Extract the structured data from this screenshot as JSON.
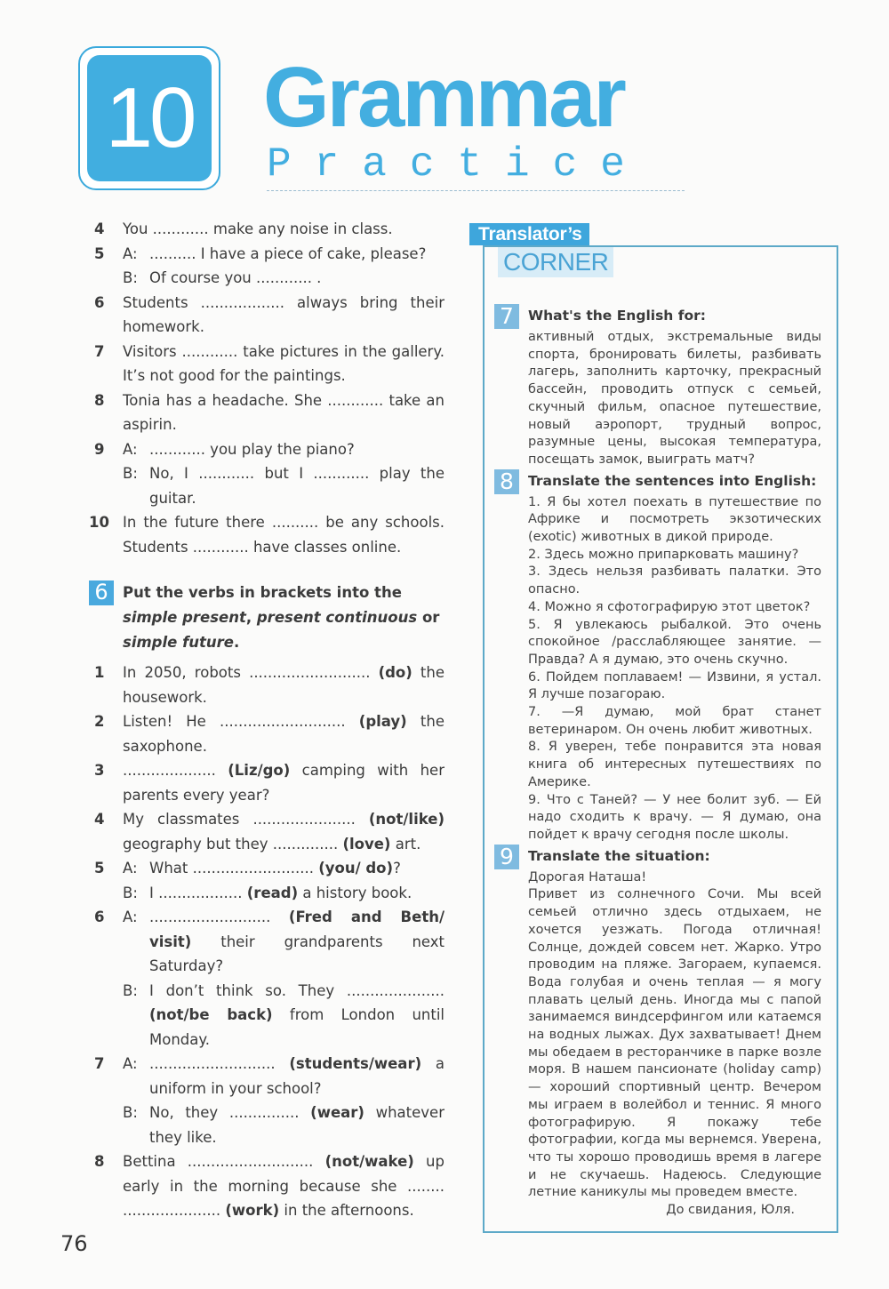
{
  "header": {
    "unit_number": "10",
    "title": "Grammar",
    "subtitle": "Practice"
  },
  "exercise5_continued": {
    "items": [
      {
        "num": "4",
        "lines": [
          {
            "label": "",
            "text": "You ............ make any noise in class."
          }
        ]
      },
      {
        "num": "5",
        "lines": [
          {
            "label": "A:",
            "text": ".......... I have a piece of cake, please?"
          },
          {
            "label": "B:",
            "text": "Of course you ............ ."
          }
        ]
      },
      {
        "num": "6",
        "lines": [
          {
            "label": "",
            "text": "Students .................. always bring their homework."
          }
        ]
      },
      {
        "num": "7",
        "lines": [
          {
            "label": "",
            "text": "Visitors ............ take pictures in the gallery. It’s not good for the paintings."
          }
        ]
      },
      {
        "num": "8",
        "lines": [
          {
            "label": "",
            "text": "Tonia has a headache. She ............ take an aspirin."
          }
        ]
      },
      {
        "num": "9",
        "lines": [
          {
            "label": "A:",
            "text": "............ you play the piano?"
          },
          {
            "label": "B:",
            "text": "No, I ............ but I ............ play the guitar."
          }
        ]
      },
      {
        "num": "10",
        "lines": [
          {
            "label": "",
            "text": "In the future there .......... be any schools. Students ............ have classes online."
          }
        ]
      }
    ]
  },
  "exercise6": {
    "number": "6",
    "instruction_start": "Put the verbs in brackets into the ",
    "instruction_i1": "simple present",
    "instruction_sep1": ", ",
    "instruction_i2": "present continuous",
    "instruction_sep2": " or ",
    "instruction_i3": "simple future",
    "instruction_end": ".",
    "items": [
      {
        "num": "1",
        "parts": [
          {
            "t": "In 2050, robots .......................... "
          },
          {
            "b": "(do)"
          },
          {
            "t": " the housework."
          }
        ]
      },
      {
        "num": "2",
        "parts": [
          {
            "t": "Listen! He ........................... "
          },
          {
            "b": "(play)"
          },
          {
            "t": " the saxophone."
          }
        ]
      },
      {
        "num": "3",
        "parts": [
          {
            "t": " .................... "
          },
          {
            "b": "(Liz/go)"
          },
          {
            "t": " camping with her parents every year?"
          }
        ]
      },
      {
        "num": "4",
        "parts": [
          {
            "t": "My classmates ...................... "
          },
          {
            "b": "(not/like)"
          },
          {
            "t": " geography but they .............. "
          },
          {
            "b": "(love)"
          },
          {
            "t": " art."
          }
        ]
      },
      {
        "num": "5",
        "sub": [
          {
            "label": "A:",
            "parts": [
              {
                "t": "What .......................... "
              },
              {
                "b": "(you/ do)"
              },
              {
                "t": "?"
              }
            ]
          },
          {
            "label": "B:",
            "parts": [
              {
                "t": "I .................. "
              },
              {
                "b": "(read)"
              },
              {
                "t": " a history book."
              }
            ]
          }
        ]
      },
      {
        "num": "6",
        "sub": [
          {
            "label": "A:",
            "parts": [
              {
                "t": ".......................... "
              },
              {
                "b": "(Fred and Beth/ visit)"
              },
              {
                "t": " their grandparents next Saturday?"
              }
            ]
          },
          {
            "label": "B:",
            "parts": [
              {
                "t": "I don’t think so. They ..................... "
              },
              {
                "b": "(not/be back)"
              },
              {
                "t": " from London until Monday."
              }
            ]
          }
        ]
      },
      {
        "num": "7",
        "sub": [
          {
            "label": "A:",
            "parts": [
              {
                "t": "........................... "
              },
              {
                "b": "(students/wear)"
              },
              {
                "t": " a uniform in your school?"
              }
            ]
          },
          {
            "label": "B:",
            "parts": [
              {
                "t": "No, they ............... "
              },
              {
                "b": "(wear)"
              },
              {
                "t": " whatever they like."
              }
            ]
          }
        ]
      },
      {
        "num": "8",
        "parts": [
          {
            "t": "Bettina ........................... "
          },
          {
            "b": "(not/wake)"
          },
          {
            "t": " up early in the morning because she ........ ..................... "
          },
          {
            "b": "(work)"
          },
          {
            "t": " in the afternoons."
          }
        ]
      }
    ]
  },
  "translators_corner": {
    "title_line1": "Translator’s",
    "title_line2": "CORNER",
    "exercise7": {
      "number": "7",
      "title": "What's the English for:",
      "text": "активный отдых, экстремальные виды спорта, бронировать билеты, разбивать лагерь, заполнить карточку, прекрасный бассейн, проводить отпуск с семьей, скучный фильм, опасное путешествие, новый аэропорт, трудный вопрос, разумные цены, высокая температура, посещать замок, выиграть матч?"
    },
    "exercise8": {
      "number": "8",
      "title": "Translate the sentences into English:",
      "sentences": [
        "1. Я бы хотел поехать в путешествие по Африке и посмотреть экзотических (exotic) животных в дикой природе.",
        "2. Здесь можно припарковать машину?",
        "3. Здесь нельзя разбивать палатки. Это опасно.",
        "4. Можно я сфотографирую этот цветок?",
        "5. Я увлекаюсь рыбалкой. Это очень спокойное /расслабляющее занятие. — Правда? А я думаю, это очень скучно.",
        "6. Пойдем поплаваем! — Извини, я устал. Я лучше позагораю.",
        "7. —Я думаю, мой брат станет ветеринаром. Он очень любит животных.",
        "8. Я уверен, тебе понравится эта новая книга об интересных путешествиях по Америке.",
        "9. Что с Таней? — У нее болит зуб. — Ей надо сходить к врачу. — Я думаю, она пойдет к врачу сегодня после школы."
      ]
    },
    "exercise9": {
      "number": "9",
      "title": "Translate the situation:",
      "greeting": "Дорогая Наташа!",
      "body": "Привет из солнечного Сочи. Мы всей семьей отлично здесь отдыхаем, не хочется уезжать. Погода отличная! Солнце, дождей совсем нет. Жарко. Утро проводим на пляже. Загораем, купаемся. Вода голубая и очень теплая — я могу плавать целый день. Иногда мы с папой занимаемся виндсерфингом или катаемся на водных лыжах. Дух захватывает! Днем мы обедаем в ресторанчике в парке возле моря. В нашем пансионате (holiday camp) — хороший спортивный центр. Вечером мы играем в волейбол и теннис. Я много фотографирую. Я покажу тебе фотографии, когда мы вернемся. Уверена, что ты хорошо проводишь время в лагере и не скучаешь. Надеюсь. Следующие летние каникулы мы проведем вместе.",
      "signature": "До свидания, Юля."
    }
  },
  "page_number": "76",
  "colors": {
    "accent_blue": "#41aee0",
    "box_border": "#5da9c8",
    "badge_light": "#7fbbe0"
  }
}
